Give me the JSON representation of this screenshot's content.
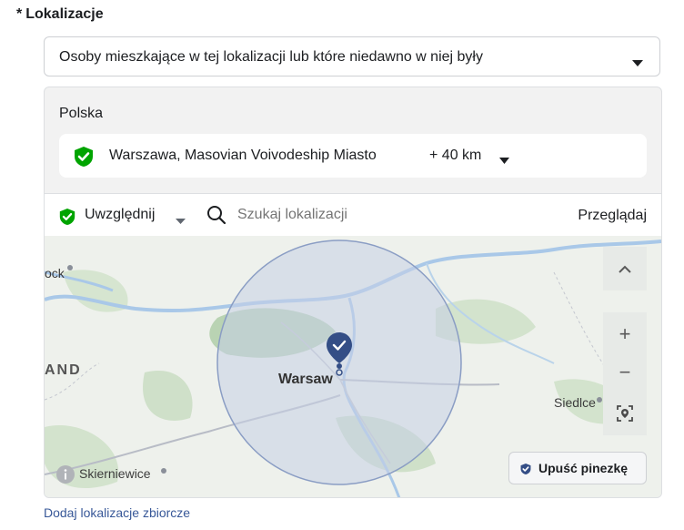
{
  "section": {
    "required_mark": "*",
    "title": "Lokalizacje"
  },
  "audience_dropdown": {
    "value": "Osoby mieszkające w tej lokalizacji lub które niedawno w niej były"
  },
  "country": "Polska",
  "location": {
    "name": "Warszawa, Masovian Voivodeship Miasto",
    "radius": "+ 40 km"
  },
  "toolbar": {
    "include_label": "Uwzględnij",
    "search_placeholder": "Szukaj lokalizacji",
    "browse_label": "Przeglądaj"
  },
  "map": {
    "labels": {
      "city_main": "Warsaw",
      "city_left": "ock",
      "country_partial": "AND",
      "city_right": "Siedlce",
      "city_bottom": "Skierniewice"
    },
    "zoom_in": "+",
    "zoom_out": "−",
    "drop_pin_label": "Upuść pinezkę"
  },
  "bulk_link": "Dodaj lokalizacje zbiorcze",
  "colors": {
    "include_green": "#00a400",
    "pin_blue": "#344e86",
    "radius_fill": "#c7d0e6",
    "link_blue": "#385898"
  }
}
